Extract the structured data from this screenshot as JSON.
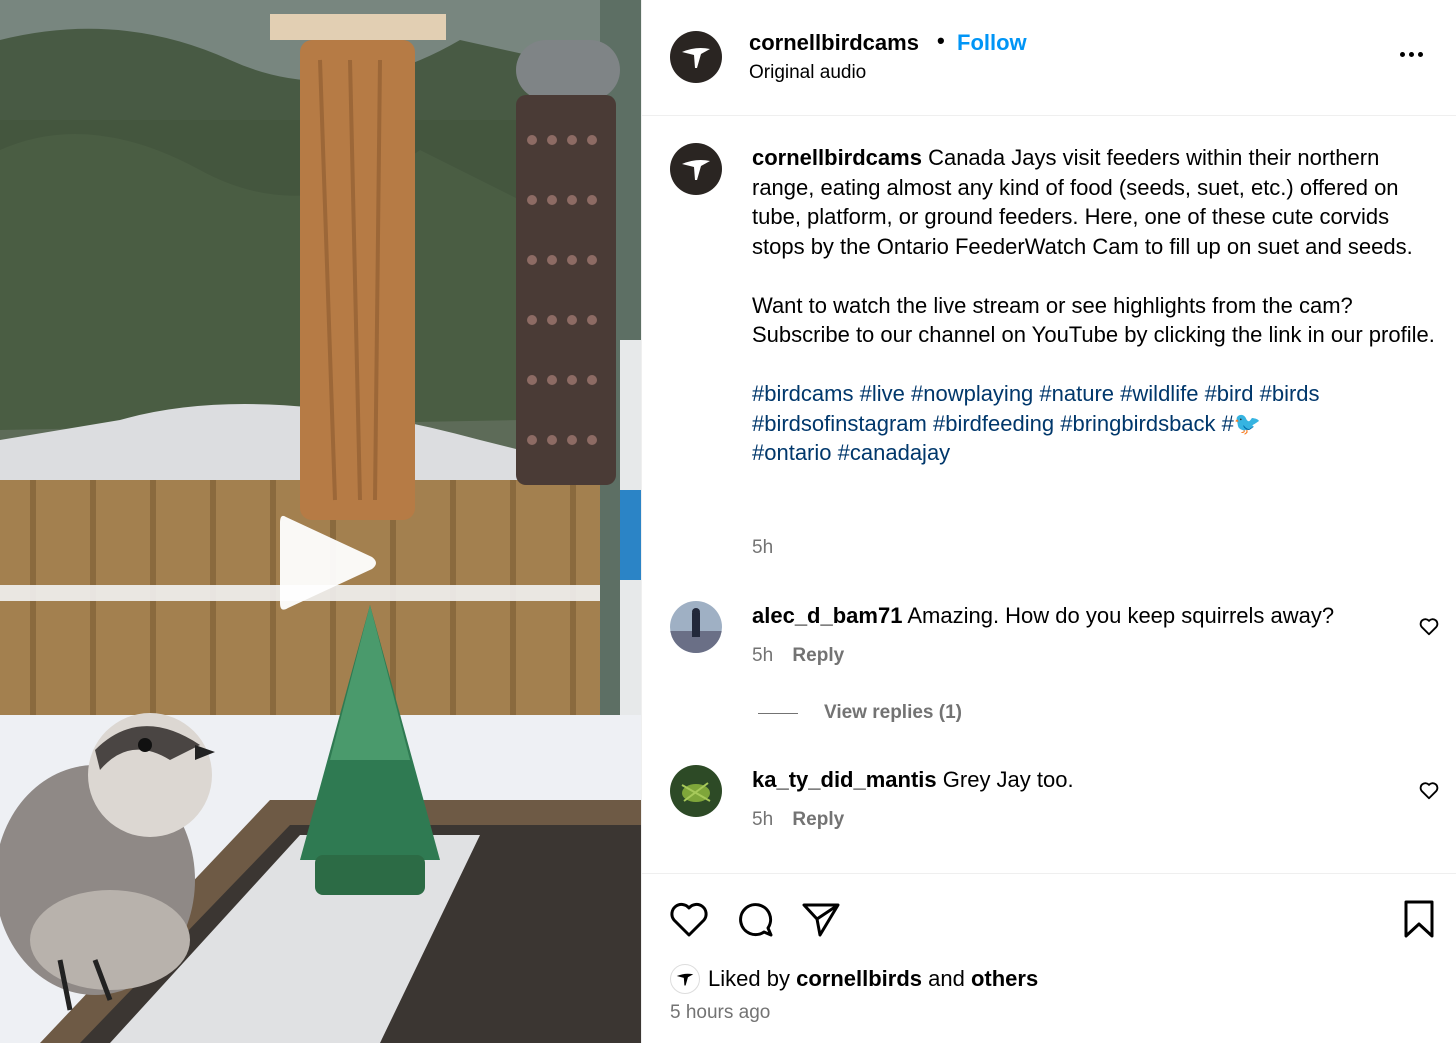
{
  "post": {
    "username": "cornellbirdcams",
    "separator": "•",
    "follow_label": "Follow",
    "audio_label": "Original audio"
  },
  "caption": {
    "username": "cornellbirdcams",
    "paragraph1": "Canada Jays visit feeders within their northern range, eating almost any kind of food (seeds, suet, etc.) offered on tube, platform, or ground feeders. Here, one of these cute corvids stops by the Ontario FeederWatch Cam to fill up on suet and seeds.",
    "paragraph2": "Want to watch the live stream or see highlights from the cam? Subscribe to our channel on YouTube by clicking the link in our profile.",
    "hashtags": [
      "#birdcams",
      "#live",
      "#nowplaying",
      "#nature",
      "#wildlife",
      "#bird",
      "#birds",
      "#birdsofinstagram",
      "#birdfeeding",
      "#bringbirdsback",
      "#🐦",
      "#ontario",
      "#canadajay"
    ],
    "time": "5h"
  },
  "comments": [
    {
      "username": "alec_d_bam71",
      "text": "Amazing. How do you keep squirrels away?",
      "time": "5h",
      "reply_label": "Reply"
    },
    {
      "username": "ka_ty_did_mantis",
      "text": "Grey Jay too.",
      "time": "5h",
      "reply_label": "Reply"
    }
  ],
  "view_replies_label": "View replies (1)",
  "likes": {
    "prefix": "Liked by",
    "user": "cornellbirds",
    "and": "and",
    "others": "others"
  },
  "post_time": "5 hours ago",
  "icons": {
    "like": "heart-icon",
    "comment": "comment-bubble-icon",
    "share": "paper-plane-icon",
    "save": "bookmark-icon",
    "more": "more-dots-icon",
    "play": "play-icon"
  },
  "colors": {
    "link_blue": "#0095f6",
    "hashtag": "#00376b",
    "muted": "#737373",
    "avatar_bg": "#2a2522"
  }
}
